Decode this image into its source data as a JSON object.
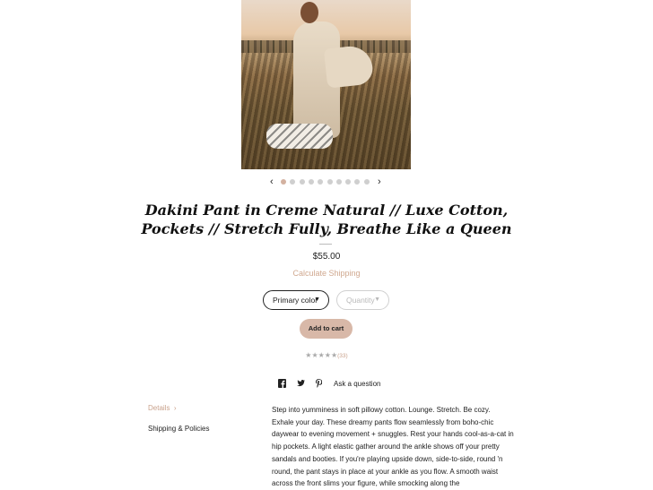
{
  "carousel": {
    "prev_icon": "chevron-left-icon",
    "next_icon": "chevron-right-icon",
    "prev_glyph": "‹",
    "next_glyph": "›",
    "dot_count": 10,
    "active_index": 0
  },
  "product": {
    "title": "Dakini Pant in Creme Natural // Luxe Cotton, Pockets // Stretch Fully, Breathe Like a Queen",
    "price": "$55.00",
    "calculate_shipping": "Calculate Shipping"
  },
  "options": {
    "color": {
      "label": "Primary color",
      "caret": "▼"
    },
    "quantity": {
      "label": "Quantity",
      "caret": "▼"
    }
  },
  "add_to_cart": "Add to cart",
  "rating": {
    "stars": "★★★★★",
    "value": 5,
    "count": "(33)"
  },
  "share": {
    "facebook_icon": "facebook-icon",
    "twitter_icon": "twitter-icon",
    "pinterest_icon": "pinterest-icon",
    "ask": "Ask a question"
  },
  "tabs": [
    {
      "label": "Details",
      "chevron": "›",
      "active": true
    },
    {
      "label": "Shipping & Policies",
      "active": false
    }
  ],
  "description": "Step into yumminess in soft pillowy cotton. Lounge. Stretch. Be cozy. Exhale your day. These dreamy pants flow seamlessly from boho-chic daywear to evening movement + snuggles. Rest your hands cool-as-a-cat in hip pockets. A light elastic gather around the ankle shows off your pretty sandals and booties. If you're playing upside down, side-to-side, round 'n round, the pant stays in place at your ankle as you flow. A smooth waist across the front slims your figure, while smocking along the",
  "colors": {
    "accent": "#d3b1a0",
    "accent_text": "#c9a28c",
    "text": "#222222"
  }
}
